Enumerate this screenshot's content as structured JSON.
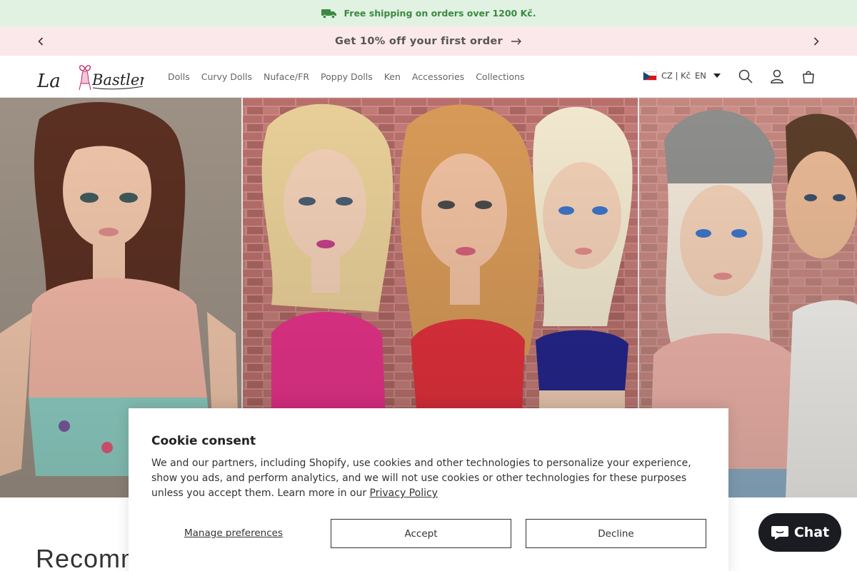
{
  "announcement": {
    "shipping_text": "Free shipping on orders over 1200 Kč.",
    "promo_text": "Get 10% off your first order"
  },
  "header": {
    "logo_text": "La Bastlera",
    "nav": [
      "Dolls",
      "Curvy Dolls",
      "Nuface/FR",
      "Poppy Dolls",
      "Ken",
      "Accessories",
      "Collections"
    ],
    "locale_label": "CZ | Kč",
    "language": "EN"
  },
  "section": {
    "heading": "Recommended"
  },
  "cookie": {
    "title": "Cookie consent",
    "body": "We and our partners, including Shopify, use cookies and other technologies to personalize your experience, show you ads, and perform analytics, and we will not use cookies or other technologies for these purposes unless you accept them. Learn more in our ",
    "policy_link": "Privacy Policy",
    "manage": "Manage preferences",
    "accept": "Accept",
    "decline": "Decline"
  },
  "chat": {
    "label": "Chat"
  },
  "colors": {
    "shipping_bg": "#e1f1e2",
    "shipping_text": "#3b8a40",
    "promo_bg": "#fbe8eb",
    "logo": "#b9286a",
    "chat_bg": "#1b1c22"
  }
}
